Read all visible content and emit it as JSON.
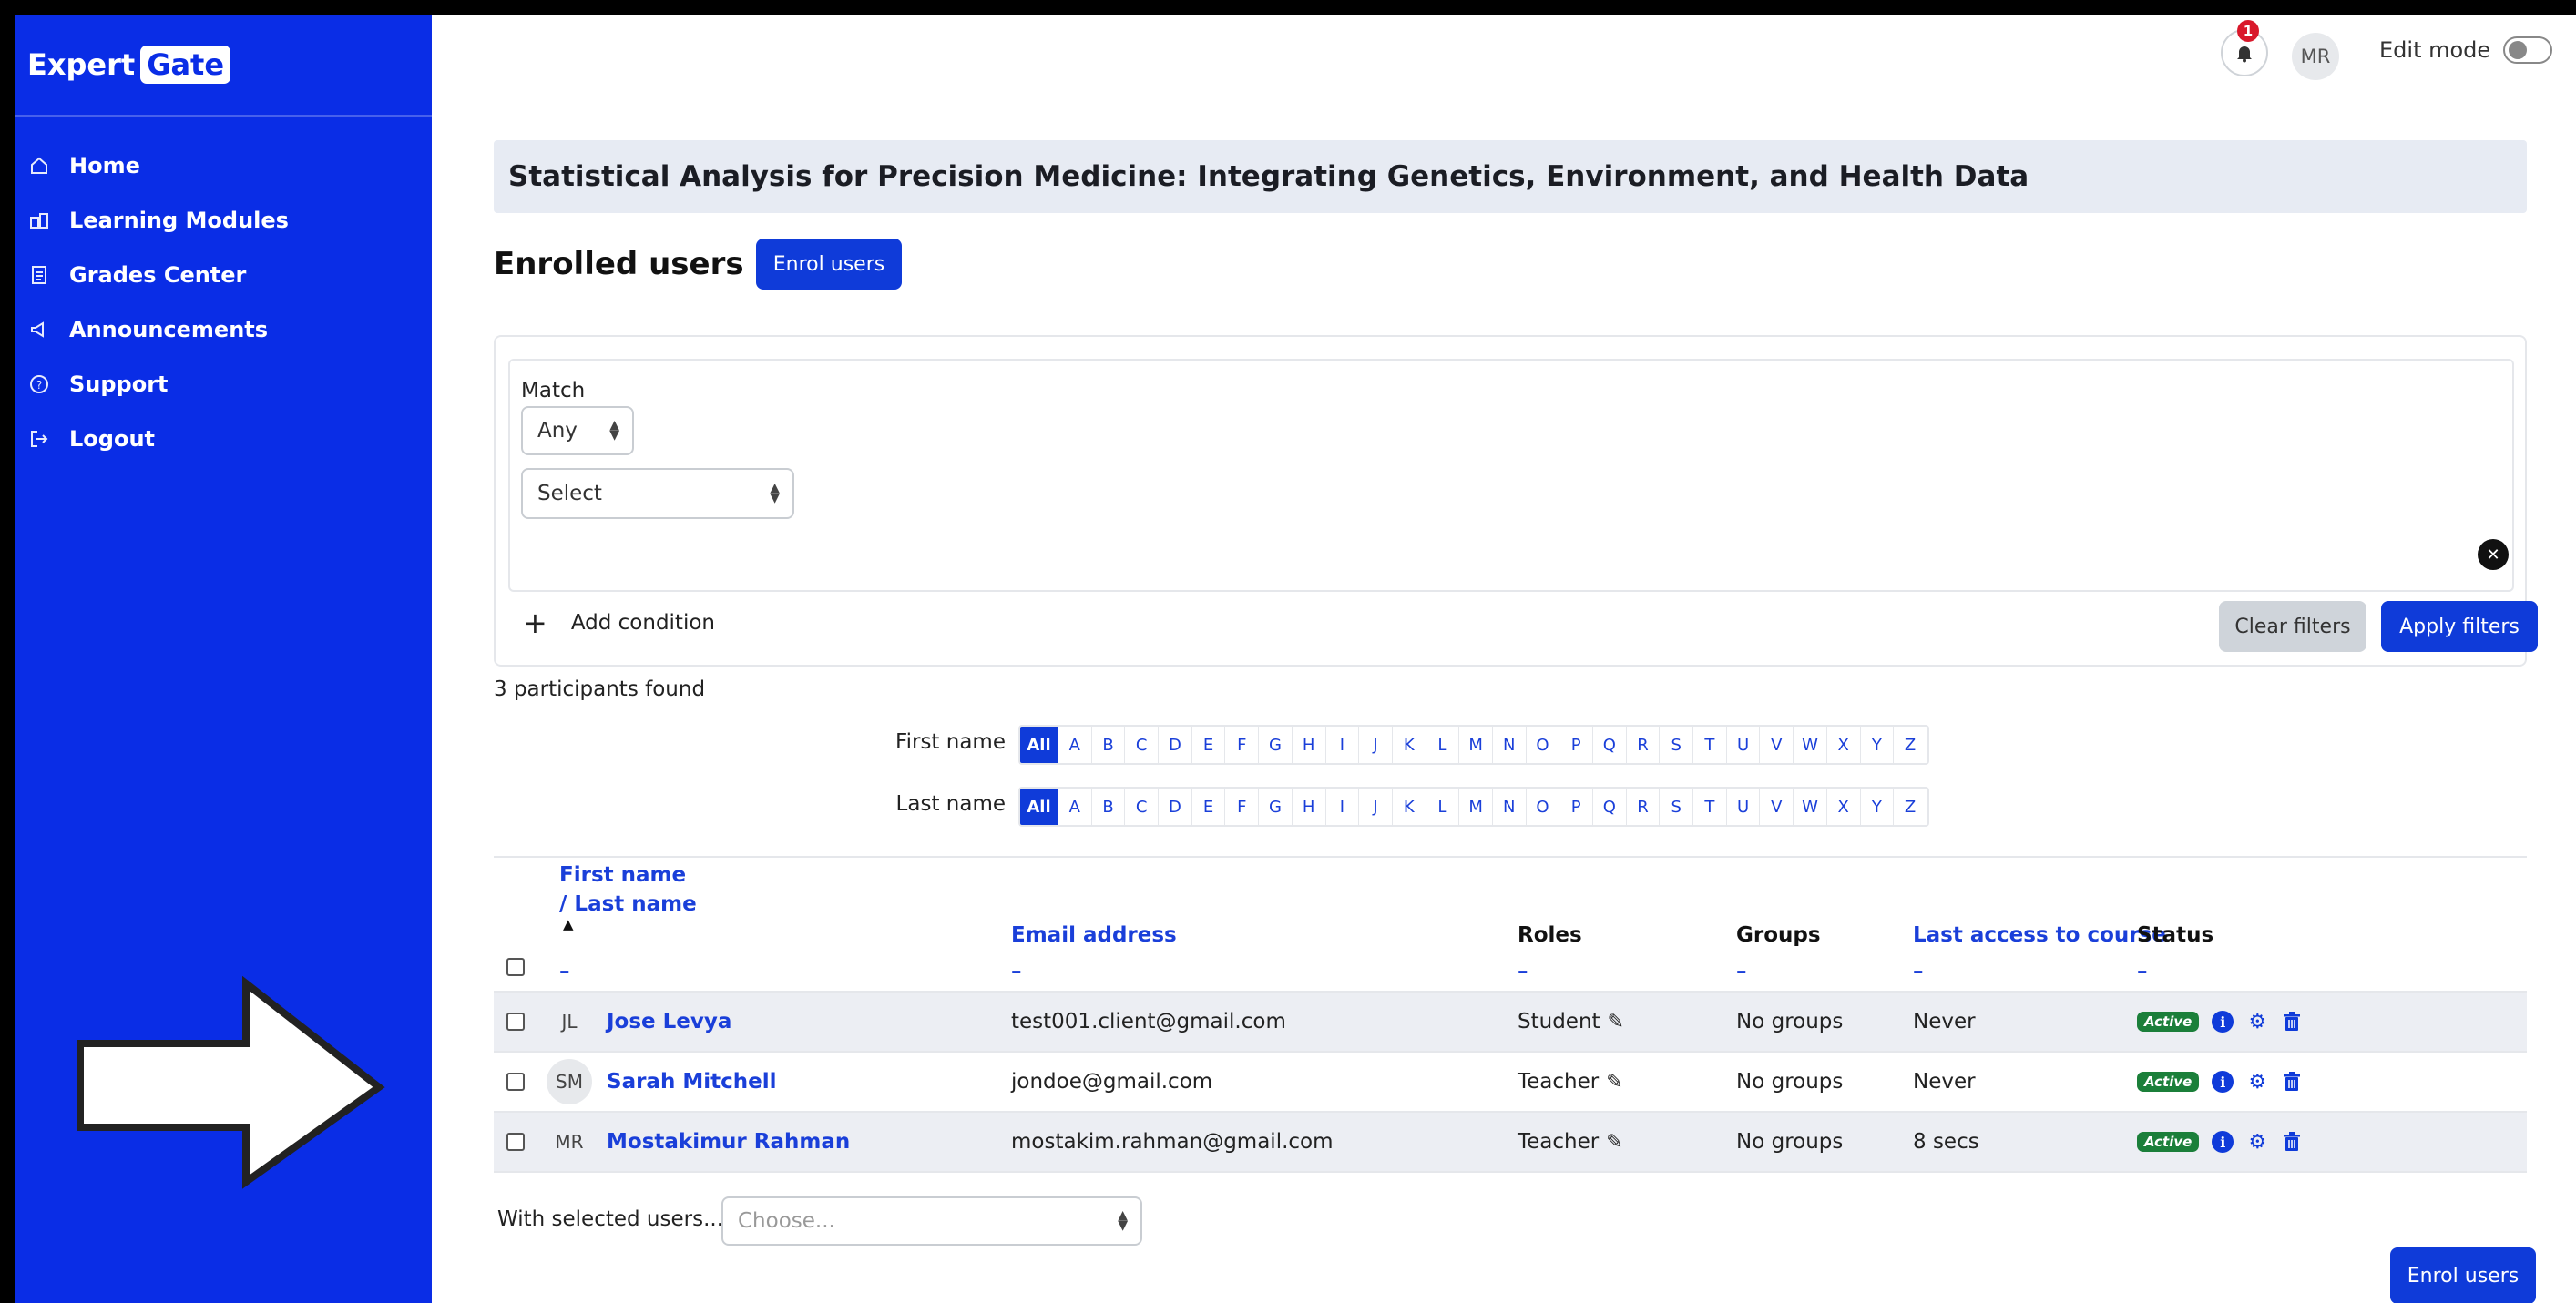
{
  "brand": {
    "name_part1": "Expert",
    "name_part2": "Gate",
    "color": "#0a2de6"
  },
  "sidebar": {
    "items": [
      {
        "label": "Home",
        "icon": "home-icon"
      },
      {
        "label": "Learning Modules",
        "icon": "modules-icon"
      },
      {
        "label": "Grades Center",
        "icon": "grades-icon"
      },
      {
        "label": "Announcements",
        "icon": "megaphone-icon"
      },
      {
        "label": "Support",
        "icon": "help-icon"
      },
      {
        "label": "Logout",
        "icon": "logout-icon"
      }
    ]
  },
  "topbar": {
    "notification_count": "1",
    "user_initials": "MR",
    "edit_mode_label": "Edit mode"
  },
  "course_title": "Statistical Analysis for Precision Medicine: Integrating Genetics, Environment, and Health Data",
  "page": {
    "title": "Enrolled users",
    "enrol_button": "Enrol users"
  },
  "filters": {
    "match_label": "Match",
    "match_value": "Any",
    "field_select_value": "Select",
    "add_condition": "Add condition",
    "clear_button": "Clear filters",
    "apply_button": "Apply filters"
  },
  "participants_found": "3 participants found",
  "initials": {
    "first_name_label": "First name",
    "last_name_label": "Last name",
    "all_label": "All",
    "letters": [
      "A",
      "B",
      "C",
      "D",
      "E",
      "F",
      "G",
      "H",
      "I",
      "J",
      "K",
      "L",
      "M",
      "N",
      "O",
      "P",
      "Q",
      "R",
      "S",
      "T",
      "U",
      "V",
      "W",
      "X",
      "Y",
      "Z"
    ]
  },
  "table": {
    "headers": {
      "first_name": "First name",
      "slash_last_name": "/ Last name",
      "email": "Email address",
      "roles": "Roles",
      "groups": "Groups",
      "last_access": "Last access to course",
      "status": "Status",
      "dash": "–"
    },
    "rows": [
      {
        "initials": "JL",
        "name": "Jose Levya",
        "email": "test001.client@gmail.com",
        "role": "Student",
        "groups": "No groups",
        "last_access": "Never",
        "status": "Active"
      },
      {
        "initials": "SM",
        "name": "Sarah Mitchell",
        "email": "jondoe@gmail.com",
        "role": "Teacher",
        "groups": "No groups",
        "last_access": "Never",
        "status": "Active"
      },
      {
        "initials": "MR",
        "name": "Mostakimur Rahman",
        "email": "mostakim.rahman@gmail.com",
        "role": "Teacher",
        "groups": "No groups",
        "last_access": "8 secs",
        "status": "Active"
      }
    ]
  },
  "bulk": {
    "label": "With selected users...",
    "placeholder": "Choose..."
  },
  "enrol_bottom": "Enrol users"
}
